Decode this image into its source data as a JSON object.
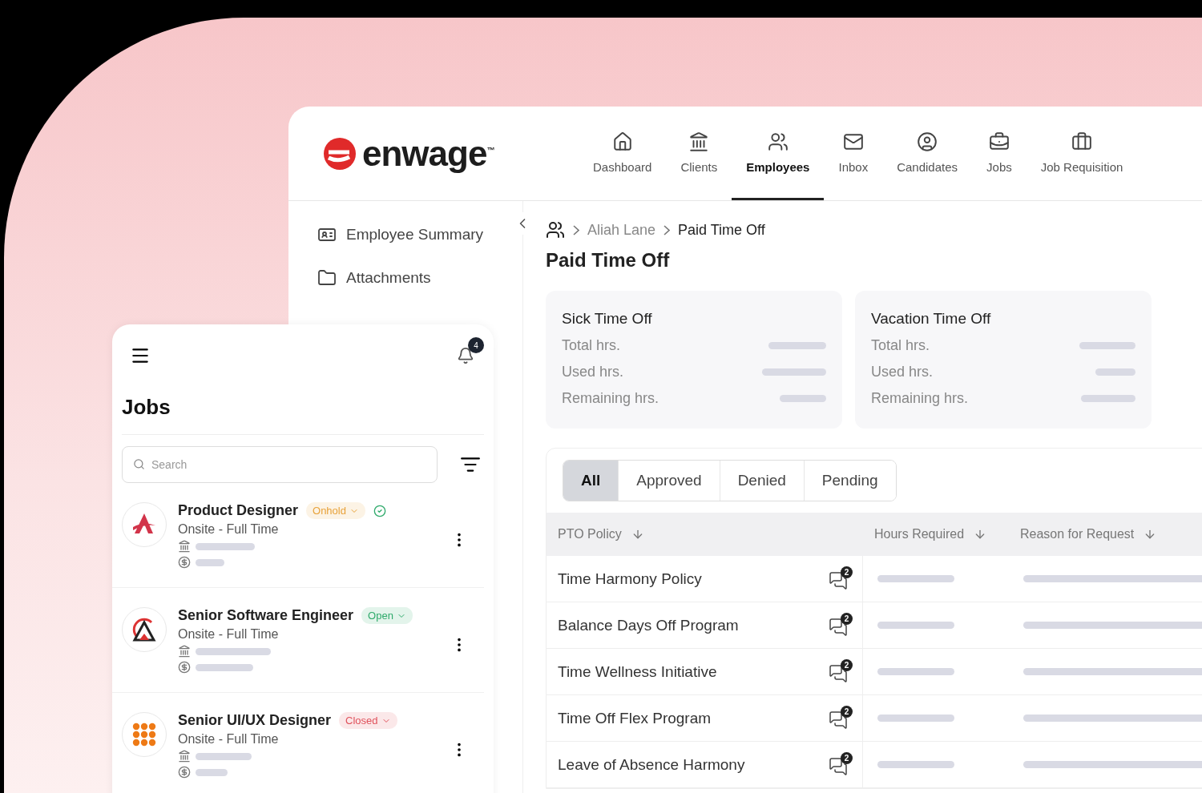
{
  "logo": {
    "text": "enwage$^{™}$"
  },
  "nav": [
    {
      "label": "Dashboard",
      "selected": false
    },
    {
      "label": "Clients",
      "selected": false
    },
    {
      "label": "Employees",
      "selected": true
    },
    {
      "label": "Inbox",
      "selected": false
    },
    {
      "label": "Candidates",
      "selected": false
    },
    {
      "label": "Jobs",
      "selected": false
    },
    {
      "label": "Job Requisition",
      "selected": false
    }
  ],
  "sidebar": {
    "items": [
      {
        "label": "Employee Summary"
      },
      {
        "label": "Attachments"
      }
    ]
  },
  "breadcrumb": [
    "Aliah Lane",
    "Paid Time Off"
  ],
  "page_title": "Paid Time Off",
  "summary_cards": [
    {
      "title": "Sick Time Off",
      "rows": [
        "Total hrs.",
        "Used hrs.",
        "Remaining hrs."
      ]
    },
    {
      "title": "Vacation Time Off",
      "rows": [
        "Total hrs.",
        "Used hrs.",
        "Remaining hrs."
      ]
    }
  ],
  "filter_tabs": [
    {
      "label": "All",
      "selected": true
    },
    {
      "label": "Approved",
      "selected": false
    },
    {
      "label": "Denied",
      "selected": false
    },
    {
      "label": "Pending",
      "selected": false
    }
  ],
  "table": {
    "columns": [
      "PTO Policy",
      "Hours Required",
      "Reason for Request"
    ],
    "rows": [
      {
        "policy": "Time Harmony Policy",
        "comments": "2"
      },
      {
        "policy": "Balance Days Off Program",
        "comments": "2"
      },
      {
        "policy": "Time Wellness Initiative",
        "comments": "2"
      },
      {
        "policy": "Time Off Flex Program",
        "comments": "2"
      },
      {
        "policy": "Leave of Absence Harmony",
        "comments": "2"
      }
    ]
  },
  "mobile": {
    "notifications": "4",
    "title": "Jobs",
    "search": {
      "placeholder": "Search"
    },
    "jobs": [
      {
        "title": "Product Designer",
        "status": "Onhold",
        "color": "#e8a23a",
        "verified": true,
        "subtitle": "Onsite - Full Time",
        "kind": "swirl"
      },
      {
        "title": "Senior Software Engineer",
        "status": "Open",
        "color": "#2faa6b",
        "verified": false,
        "subtitle": "Onsite - Full Time",
        "kind": "peak"
      },
      {
        "title": "Senior UI/UX Designer",
        "status": "Closed",
        "color": "#e0525c",
        "verified": false,
        "subtitle": "Onsite - Full Time",
        "kind": "dots"
      }
    ]
  }
}
